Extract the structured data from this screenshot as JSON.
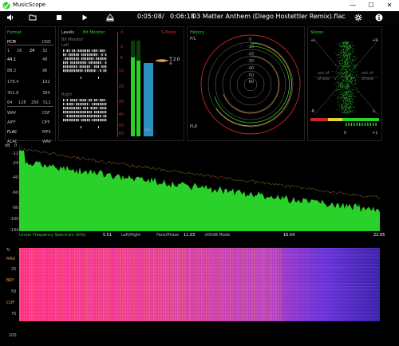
{
  "window": {
    "title": "MusicScope",
    "min": "—",
    "max": "☐",
    "close": "✕"
  },
  "toolbar": {
    "elapsed": "0:05:08",
    "separator": "/",
    "total": "0:06:18",
    "track": "03 Matter Anthem (Diego Hostettler Remix).flac"
  },
  "format": {
    "title": "Format",
    "pcm": "PCM",
    "dsd": "DSD",
    "bits": [
      "1",
      "16",
      "24",
      "32"
    ],
    "rates_left": [
      "44.1",
      "88.2",
      "176.4",
      "352.8"
    ],
    "rates_right": [
      "48",
      "96",
      "192",
      "384"
    ],
    "dsd_rates": [
      "64",
      "128",
      "256",
      "512"
    ],
    "types_left": [
      "WAV",
      "AIFF",
      "FLAC",
      "ALAC"
    ],
    "types_right": [
      "DSF",
      "DFF",
      "MP3",
      "WAV"
    ]
  },
  "levels": {
    "title": "Levels",
    "bitmonitor": "Bit Monitor",
    "bitmonitor2": "Bit Monitor",
    "left": "Left",
    "right": "Right",
    "scale": [
      "0",
      "-3",
      "-6",
      "-12",
      "-20",
      "-30",
      "-40",
      "-50",
      "-60"
    ],
    "smode": "S-Mode",
    "val2": "2.0",
    "lu": "LU"
  },
  "history": {
    "title": "History",
    "pl": "P/L",
    "plr": "PLR",
    "rings": [
      "0",
      "-10",
      "-20",
      "-30",
      "-40",
      "-50",
      "-60"
    ]
  },
  "stereo": {
    "title": "Stereo",
    "pl": "+L",
    "pr": "+R",
    "ml": "-R",
    "mr": "-L",
    "oop1": "out of",
    "oop2": "phase",
    "oop3": "out of",
    "oop4": "phase",
    "zero": "0",
    "plus1": "+1"
  },
  "spectrum": {
    "db_label": "dB",
    "ylabels": [
      "0",
      "-12",
      "-24",
      "-40",
      "-60",
      "-80",
      "-100",
      "-144"
    ],
    "xlabels": [
      "0",
      "5.51",
      "11.03",
      "16.54",
      "22.05"
    ],
    "legend": [
      "Linear Frequency Spectrum (kHz)",
      "Left/Right",
      "Pans/Phase",
      "-200dB Mode"
    ]
  },
  "spectrogram": {
    "ylabels": [
      "%",
      "MAX",
      "25",
      "BRY",
      "50",
      "COF",
      "75",
      "100"
    ]
  },
  "colors": {
    "green": "#2bd12b",
    "orange": "#e8a23a",
    "red": "#c62828",
    "blue": "#2b8fc4"
  }
}
